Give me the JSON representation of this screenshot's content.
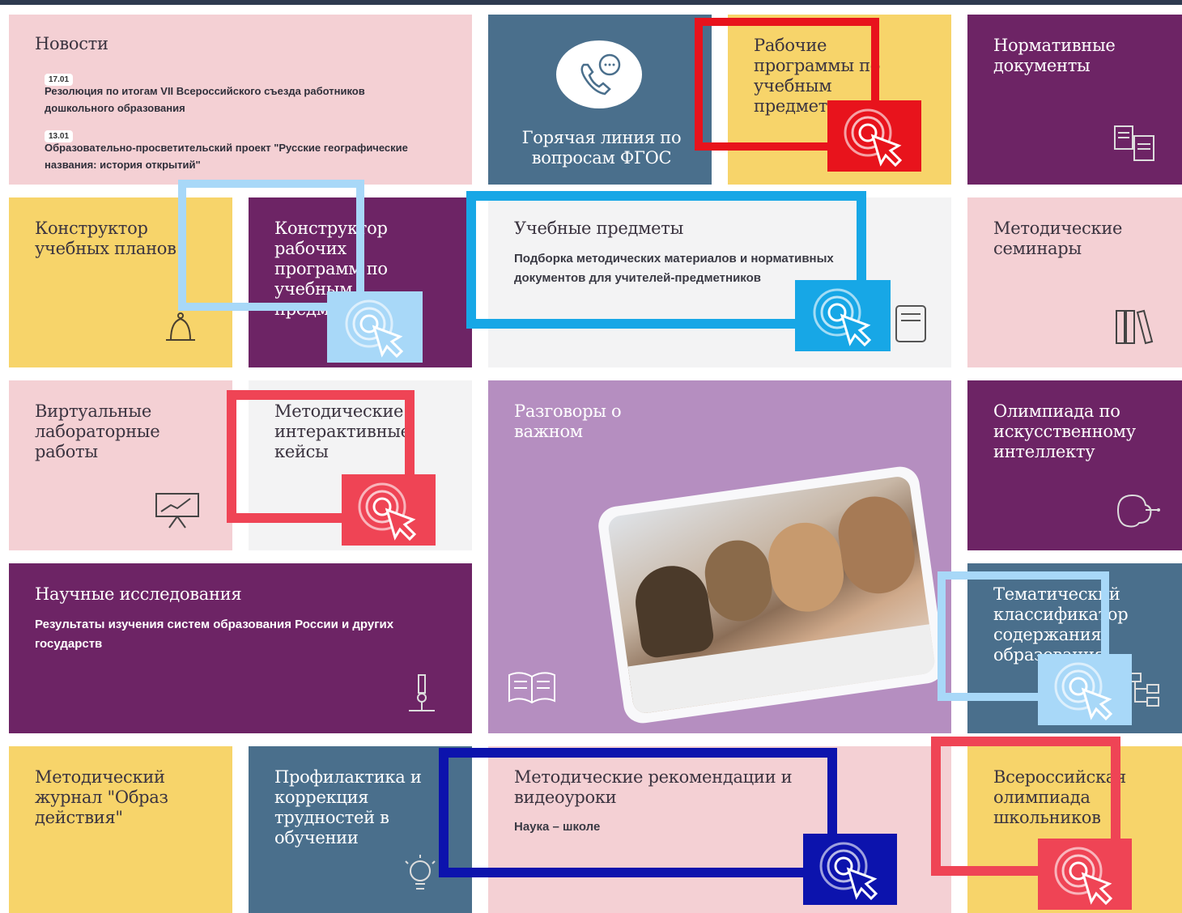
{
  "news": {
    "title": "Новости",
    "items": [
      {
        "date": "17.01",
        "text": "Резолюция по итогам  VII  Всероссийского съезда работников дошкольного образования"
      },
      {
        "date": "13.01",
        "text": "Образовательно-просветительский проект \"Русские географические названия: история открытий\""
      }
    ]
  },
  "hotline": {
    "title": "Горячая линия по вопросам ФГОС"
  },
  "work_programs": {
    "title": "Рабочие программы по учебным предметам"
  },
  "normative_docs": {
    "title": "Нормативные документы"
  },
  "curriculum_builder": {
    "title": "Конструктор учебных планов"
  },
  "program_builder": {
    "title": "Конструктор рабочих программ по учебным предметам"
  },
  "subjects": {
    "title": "Учебные предметы",
    "description": "Подборка методических материалов и нормативных документов для учителей-предметников"
  },
  "seminars": {
    "title": "Методические семинары"
  },
  "virtual_labs": {
    "title": "Виртуальные лабораторные работы"
  },
  "cases": {
    "title": "Методические интерактивные кейсы"
  },
  "conversations": {
    "title": "Разговоры о важном"
  },
  "ai_olympiad": {
    "title": "Олимпиада по искусственному интеллекту"
  },
  "research": {
    "title": "Научные исследования",
    "description": "Результаты изучения систем образования России и других государств"
  },
  "classifier": {
    "title": "Тематический классификатор содержания образования"
  },
  "journal": {
    "title": "Методический журнал \"Образ действия\""
  },
  "prevention": {
    "title": "Профилактика и коррекция трудностей в обучении"
  },
  "recommendations": {
    "title": "Методические рекомендации и видеоуроки",
    "description": "Наука – школе"
  },
  "olympiad": {
    "title": "Всероссийская олимпиада школьников"
  },
  "colors": {
    "pink": "#f4d0d4",
    "purple": "#6d2465",
    "slate": "#4a6f8c",
    "yellow": "#f7d46a",
    "lilac": "#b58ec0",
    "highlight_red": "#e8131c",
    "highlight_coral": "#ef4455",
    "highlight_lightblue": "#a8d8f8",
    "highlight_cyan": "#17a7e6",
    "highlight_navy": "#0c13ad"
  },
  "icons": [
    "phone-chat-icon",
    "documents-icon",
    "bell-icon",
    "books-icon",
    "presentation-icon",
    "microscope-icon",
    "open-book-icon",
    "brain-circuit-icon",
    "hierarchy-icon",
    "lightbulb-icon",
    "document-list-icon",
    "click-cursor-icon"
  ]
}
